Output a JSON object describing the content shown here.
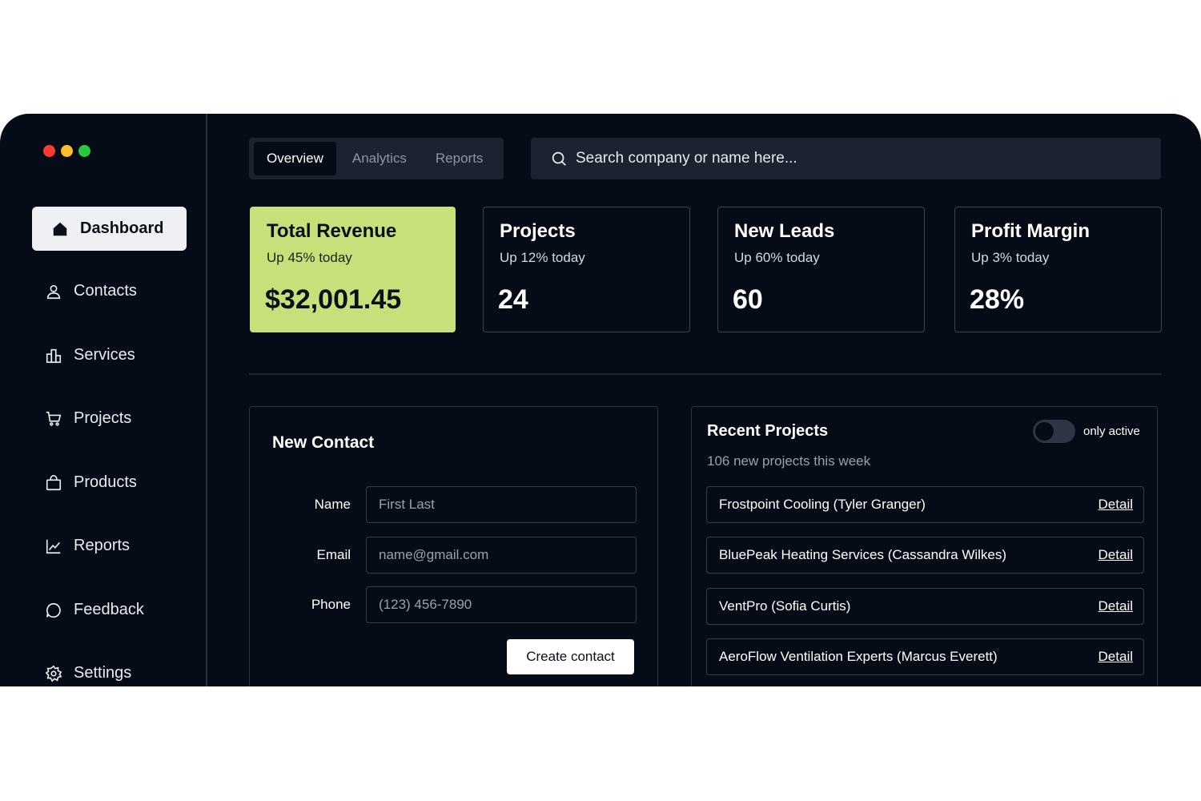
{
  "colors": {
    "window_bg": "#060c17",
    "accent": "#c6e07a",
    "traffic_red": "#ff3b30",
    "traffic_yellow": "#ffbd2e",
    "traffic_green": "#28c840"
  },
  "sidebar": {
    "items": [
      {
        "label": "Dashboard",
        "icon": "home-icon"
      },
      {
        "label": "Contacts",
        "icon": "user-icon"
      },
      {
        "label": "Services",
        "icon": "building-icon"
      },
      {
        "label": "Projects",
        "icon": "cart-icon"
      },
      {
        "label": "Products",
        "icon": "bag-icon"
      },
      {
        "label": "Reports",
        "icon": "chart-line-icon"
      },
      {
        "label": "Feedback",
        "icon": "message-icon"
      },
      {
        "label": "Settings",
        "icon": "gear-icon"
      }
    ]
  },
  "tabs": [
    {
      "label": "Overview"
    },
    {
      "label": "Analytics"
    },
    {
      "label": "Reports"
    }
  ],
  "search": {
    "placeholder": "Search company or name here...",
    "icon": "search-icon"
  },
  "stats": [
    {
      "title": "Total Revenue",
      "sub": "Up 45% today",
      "value": "$32,001.45"
    },
    {
      "title": "Projects",
      "sub": "Up 12% today",
      "value": "24"
    },
    {
      "title": "New Leads",
      "sub": "Up 60% today",
      "value": "60"
    },
    {
      "title": "Profit Margin",
      "sub": "Up 3% today",
      "value": "28%"
    }
  ],
  "contact_form": {
    "title": "New Contact",
    "fields": [
      {
        "label": "Name",
        "placeholder": "First Last"
      },
      {
        "label": "Email",
        "placeholder": "name@gmail.com"
      },
      {
        "label": "Phone",
        "placeholder": "(123) 456-7890"
      }
    ],
    "submit_label": "Create contact"
  },
  "recent_projects": {
    "title": "Recent Projects",
    "subtitle": "106 new projects this week",
    "toggle_label": "only active",
    "toggle_on": false,
    "items": [
      {
        "name": "Frostpoint Cooling (Tyler Granger)",
        "link": "Detail"
      },
      {
        "name": "BluePeak Heating Services (Cassandra Wilkes)",
        "link": "Detail"
      },
      {
        "name": "VentPro (Sofia Curtis)",
        "link": "Detail"
      },
      {
        "name": "AeroFlow Ventilation Experts (Marcus Everett)",
        "link": "Detail"
      }
    ]
  }
}
